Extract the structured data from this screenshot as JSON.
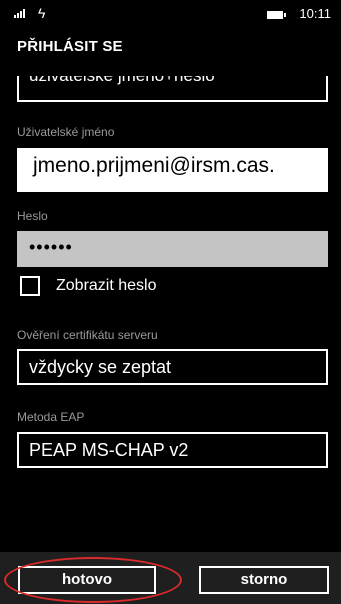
{
  "status_bar": {
    "signal_icon": "signal-strength-icon",
    "wifi_icon": "wifi-icon",
    "battery_icon": "battery-icon",
    "time": "10:11"
  },
  "header": {
    "title": "PŘIHLÁSIT SE"
  },
  "clipped_field": {
    "value": "uživatelské jméno+heslo"
  },
  "username": {
    "label": "Uživatelské jméno",
    "value": "jmeno.prijmeni@irsm.cas."
  },
  "password": {
    "label": "Heslo",
    "value": "••••••"
  },
  "show_password": {
    "label": "Zobrazit heslo",
    "checked": false
  },
  "certificate": {
    "label": "Ověření certifikátu serveru",
    "value": "vždycky se zeptat"
  },
  "eap": {
    "label": "Metoda EAP",
    "value": "PEAP MS-CHAP v2"
  },
  "app_bar": {
    "done_label": "hotovo",
    "cancel_label": "storno"
  },
  "annotation": {
    "color": "#d92b2b"
  }
}
